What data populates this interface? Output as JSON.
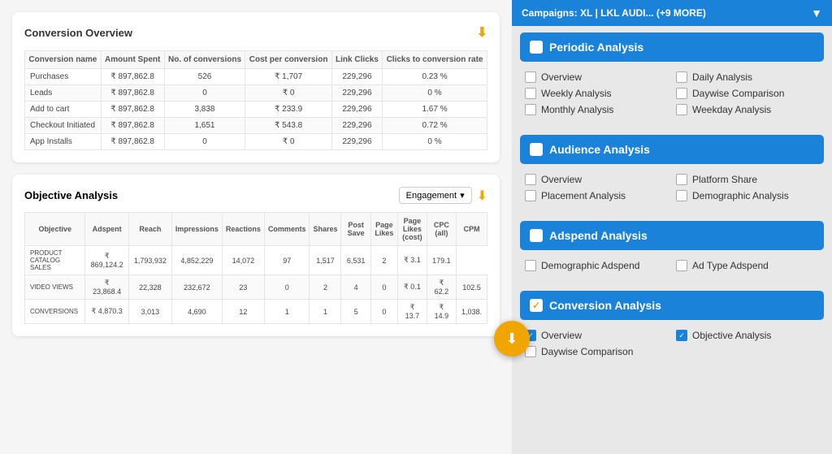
{
  "campaigns_header": {
    "label": "Campaigns:  XL | LKL AUDI... (+9 MORE)",
    "filter_icon": "▼"
  },
  "conversion_overview": {
    "title": "Conversion Overview",
    "columns": [
      "Conversion name",
      "Amount Spent",
      "No. of conversions",
      "Cost per conversion",
      "Link Clicks",
      "Clicks to conversion rate"
    ],
    "rows": [
      [
        "Purchases",
        "₹ 897,862.8",
        "526",
        "₹ 1,707",
        "229,296",
        "0.23 %"
      ],
      [
        "Leads",
        "₹ 897,862.8",
        "0",
        "₹ 0",
        "229,296",
        "0 %"
      ],
      [
        "Add to cart",
        "₹ 897,862.8",
        "3,838",
        "₹ 233.9",
        "229,296",
        "1.67 %"
      ],
      [
        "Checkout Initiated",
        "₹ 897,862.8",
        "1,651",
        "₹ 543.8",
        "229,296",
        "0.72 %"
      ],
      [
        "App Installs",
        "₹ 897,862.8",
        "0",
        "₹ 0",
        "229,296",
        "0 %"
      ]
    ]
  },
  "objective_analysis": {
    "title": "Objective Analysis",
    "engagement_label": "Engagement",
    "columns": [
      "Objective",
      "Adspent",
      "Reach",
      "Impressions",
      "Reactions",
      "Comments",
      "Shares",
      "Post Save",
      "Page Likes",
      "Page Likes (cost)",
      "CPC (all)",
      "CPM"
    ],
    "rows": [
      [
        "PRODUCT CATALOG SALES",
        "₹ 869,124.2",
        "1,793,932",
        "4,852,229",
        "14,072",
        "97",
        "1,517",
        "6,531",
        "2",
        "₹ 3.1",
        "179.1"
      ],
      [
        "VIDEO VIEWS",
        "₹ 23,868.4",
        "22,328",
        "232,672",
        "23",
        "0",
        "2",
        "4",
        "0",
        "₹ 0.1",
        "₹ 62.2",
        "102.5"
      ],
      [
        "CONVERSIONS",
        "₹ 4,870.3",
        "3,013",
        "4,690",
        "12",
        "1",
        "1",
        "5",
        "0",
        "₹ 13.7",
        "₹ 14.9",
        "1,038."
      ]
    ]
  },
  "periodic_analysis": {
    "title": "Periodic Analysis",
    "options": [
      {
        "label": "Overview",
        "checked": false,
        "col": 0
      },
      {
        "label": "Daily Analysis",
        "checked": false,
        "col": 1
      },
      {
        "label": "Weekly Analysis",
        "checked": false,
        "col": 0
      },
      {
        "label": "Daywise Comparison",
        "checked": false,
        "col": 1
      },
      {
        "label": "Monthly Analysis",
        "checked": false,
        "col": 0
      },
      {
        "label": "Weekday Analysis",
        "checked": false,
        "col": 1
      }
    ]
  },
  "audience_analysis": {
    "title": "Audience Analysis",
    "options": [
      {
        "label": "Overview",
        "checked": false
      },
      {
        "label": "Platform Share",
        "checked": false
      },
      {
        "label": "Placement Analysis",
        "checked": false
      },
      {
        "label": "Demographic Analysis",
        "checked": false
      }
    ]
  },
  "adspend_analysis": {
    "title": "Adspend Analysis",
    "options": [
      {
        "label": "Demographic Adspend",
        "checked": false
      },
      {
        "label": "Ad Type Adspend",
        "checked": false
      }
    ]
  },
  "conversion_analysis": {
    "title": "Conversion Analysis",
    "options": [
      {
        "label": "Overview",
        "checked": true
      },
      {
        "label": "Objective Analysis",
        "checked": true
      },
      {
        "label": "Daywise Comparison",
        "checked": false
      }
    ]
  }
}
